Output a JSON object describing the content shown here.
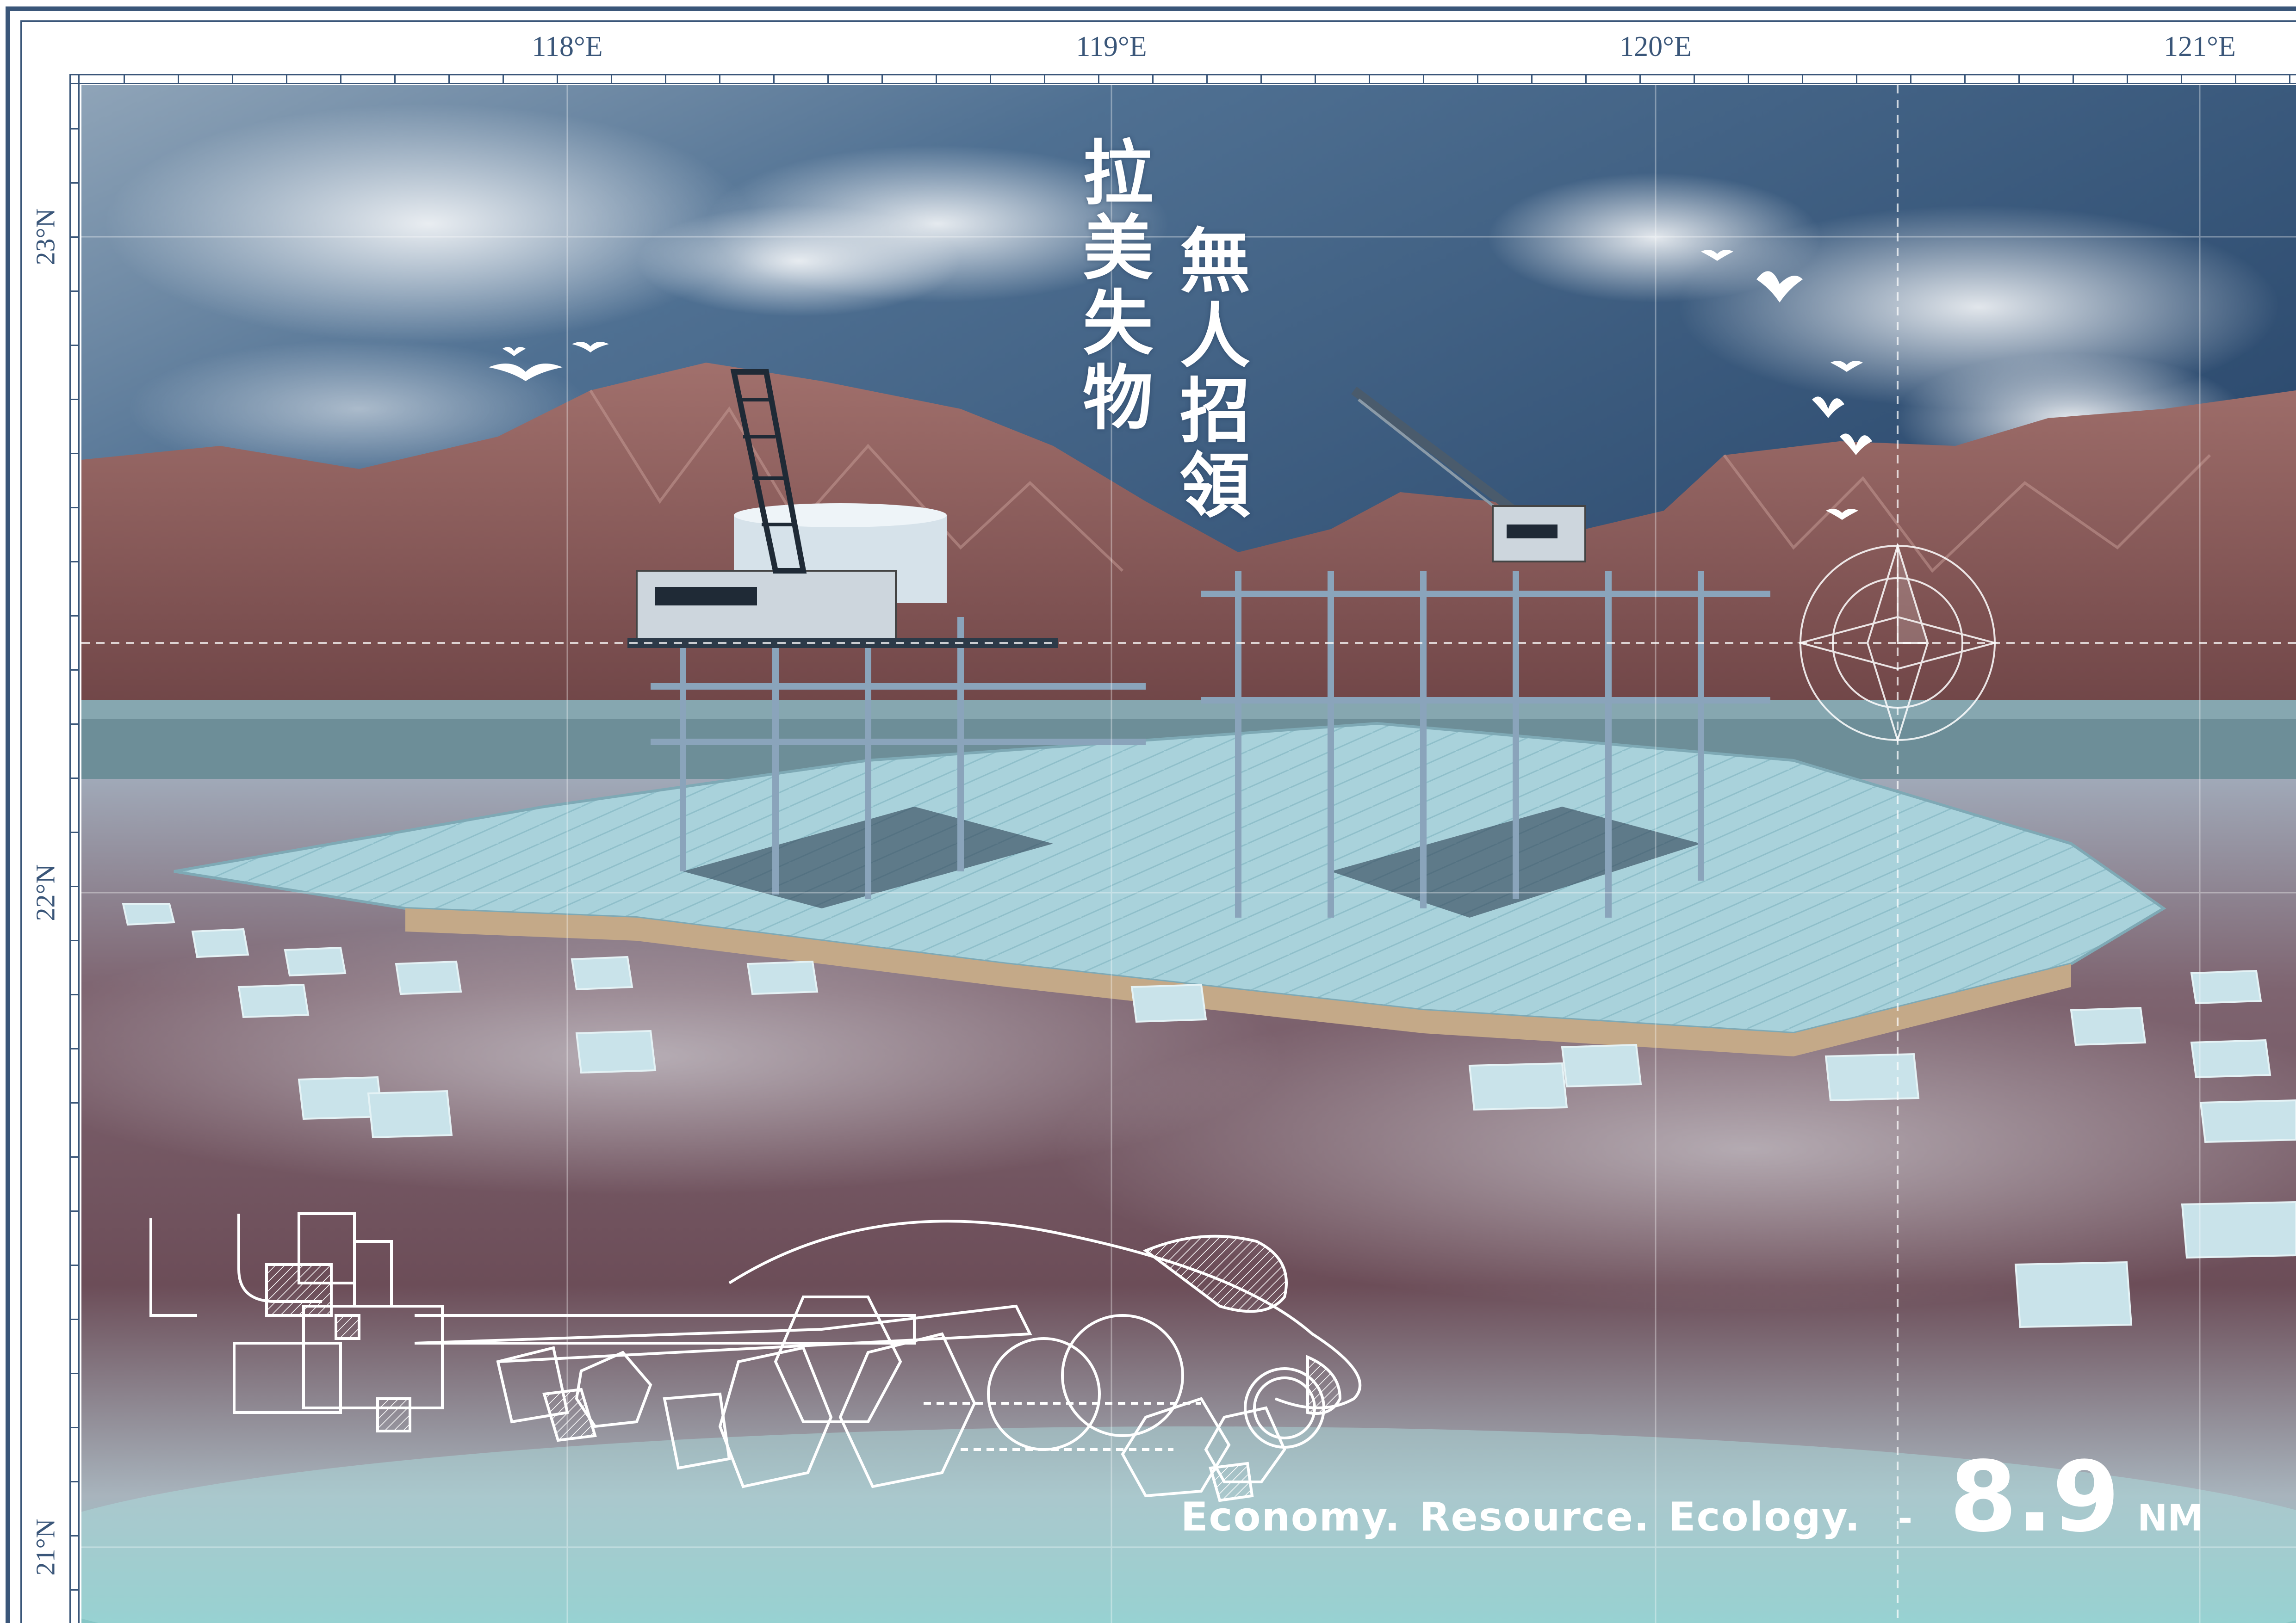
{
  "poster": {
    "title_line_1": "拉美失物",
    "title_line_2": "無人招領",
    "tagline_words": [
      "Economy.",
      "Resource.",
      "Ecology."
    ],
    "tagline_separator": "-",
    "distance_value": "8.9",
    "distance_unit": "NM"
  },
  "graticule": {
    "longitude_labels": [
      "118°E",
      "119°E",
      "120°E",
      "121°E"
    ],
    "latitude_labels": [
      "23°N",
      "22°N",
      "21°N"
    ]
  },
  "colors": {
    "frame": "#3a5679",
    "sky": "#3f6486",
    "mountains": "#8e5a58",
    "water": "#7a5a62",
    "platform_tiles": "#a9d2db",
    "text": "#ffffff"
  },
  "icons": [
    "bird-icon",
    "compass-rose-icon",
    "crane-icon",
    "tank-icon"
  ]
}
